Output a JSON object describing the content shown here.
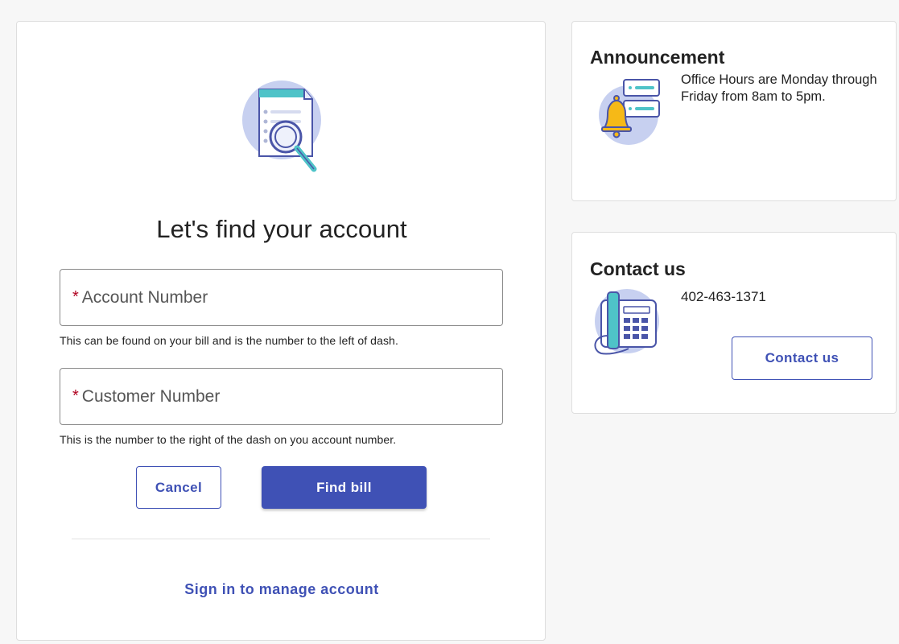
{
  "find_account": {
    "title": "Let's find your account",
    "account_field": {
      "required_marker": "*",
      "placeholder": "Account Number",
      "helper": "This can be found on your bill and is the number to the left of dash."
    },
    "customer_field": {
      "required_marker": "*",
      "placeholder": "Customer Number",
      "helper": "This is the number to the right of the dash on you account number."
    },
    "cancel_label": "Cancel",
    "find_label": "Find bill",
    "signin_label": "Sign in to manage account"
  },
  "announcement": {
    "title": "Announcement",
    "text": "Office Hours are Monday through Friday from 8am to 5pm."
  },
  "contact": {
    "title": "Contact us",
    "phone": "402-463-1371",
    "button_label": "Contact us"
  },
  "colors": {
    "primary": "#3f51b5",
    "required": "#b00020",
    "icon_circle": "#c7d0f0",
    "icon_teal": "#4fc3c8",
    "icon_bell": "#f6b917"
  },
  "icons": {
    "hero": "document-search-icon",
    "announcement": "bell-notification-icon",
    "contact": "desk-phone-icon"
  }
}
